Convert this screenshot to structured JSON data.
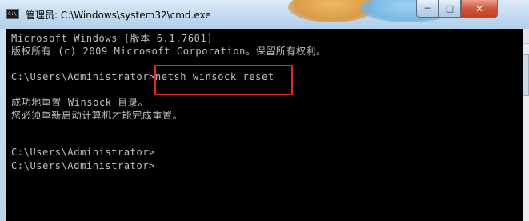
{
  "window": {
    "title": "管理员: C:\\Windows\\system32\\cmd.exe",
    "icon_text": "C:\\",
    "icon_name": "cmd-window-icon",
    "buttons": {
      "minimize_symbol": "─",
      "maximize_symbol": "□",
      "close_symbol": "✕"
    }
  },
  "console": {
    "lines": [
      "Microsoft Windows [版本 6.1.7601]",
      "版权所有 (c) 2009 Microsoft Corporation。保留所有权利。",
      "",
      "C:\\Users\\Administrator>netsh winsock reset",
      "",
      "成功地重置 Winsock 目录。",
      "您必须重新启动计算机才能完成重置。",
      "",
      "",
      "C:\\Users\\Administrator>",
      "C:\\Users\\Administrator>"
    ],
    "text_color": "#c0c0c0",
    "background_color": "#000000"
  },
  "annotation": {
    "highlight_color": "#e0292a"
  }
}
